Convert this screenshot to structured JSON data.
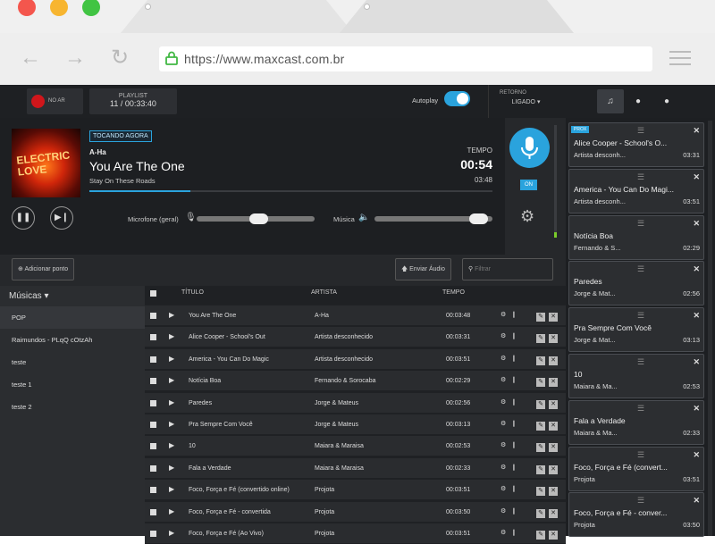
{
  "browser": {
    "url": "https://www.maxcast.com.br",
    "colors": {
      "close": "#f4564d",
      "minimize": "#f7b530",
      "maximize": "#41c443"
    }
  },
  "topbar": {
    "record_label": "NO AR",
    "playlist_label": "PLAYLIST",
    "playlist_value": "11 / 00:33:40",
    "autoplay_label": "Autoplay",
    "autoplay_on": true,
    "retorno_label": "RETORNO",
    "retorno_value": "LIGADO"
  },
  "nowplaying": {
    "badge": "TOCANDO AGORA",
    "artist": "A-Ha",
    "title": "You Are The One",
    "album": "Stay On These Roads",
    "tempo_label": "TEMPO",
    "elapsed": "00:54",
    "duration": "03:48",
    "progress": 0.25,
    "cover_text": "ELECTRIC LOVE",
    "mic_label": "Microfone (geral)",
    "music_label": "Música",
    "mic_level": 0.52,
    "music_level": 0.88
  },
  "mic": {
    "on_label": "ON"
  },
  "actions": {
    "add_label": "Adicionar ponto",
    "send_audio_label": "Enviar Áudio",
    "filter_placeholder": "Filtrar"
  },
  "sidebar": {
    "header": "Músicas",
    "items": [
      "POP",
      "Raimundos - PLqQ cOtzAh",
      "teste",
      "teste 1",
      "teste 2"
    ]
  },
  "table": {
    "headers": {
      "title": "TÍTULO",
      "artist": "ARTISTA",
      "time": "TEMPO"
    },
    "rows": [
      {
        "title": "You Are The One",
        "artist": "A-Ha",
        "time": "00:03:48"
      },
      {
        "title": "Alice Cooper - School's Out",
        "artist": "Artista desconhecido",
        "time": "00:03:31"
      },
      {
        "title": "America - You Can Do Magic",
        "artist": "Artista desconhecido",
        "time": "00:03:51"
      },
      {
        "title": "Notícia Boa",
        "artist": "Fernando & Sorocaba",
        "time": "00:02:29"
      },
      {
        "title": "Paredes",
        "artist": "Jorge & Mateus",
        "time": "00:02:56"
      },
      {
        "title": "Pra Sempre Com Você",
        "artist": "Jorge & Mateus",
        "time": "00:03:13"
      },
      {
        "title": "10",
        "artist": "Maiara & Maraisa",
        "time": "00:02:53"
      },
      {
        "title": "Fala a Verdade",
        "artist": "Maiara & Maraisa",
        "time": "00:02:33"
      },
      {
        "title": "Foco, Força e Fé (convertido online)",
        "artist": "Projota",
        "time": "00:03:51"
      },
      {
        "title": "Foco, Força e Fé - convertida",
        "artist": "Projota",
        "time": "00:03:50"
      },
      {
        "title": "Foco, Força e Fé (Ao Vivo)",
        "artist": "Projota",
        "time": "00:03:51"
      }
    ]
  },
  "queue": {
    "next_badge": "PROX",
    "items": [
      {
        "title": "Alice Cooper - School's O...",
        "artist": "Artista desconh...",
        "time": "03:31"
      },
      {
        "title": "America - You Can Do Magi...",
        "artist": "Artista desconh...",
        "time": "03:51"
      },
      {
        "title": "Notícia Boa",
        "artist": "Fernando & S...",
        "time": "02:29"
      },
      {
        "title": "Paredes",
        "artist": "Jorge & Mat...",
        "time": "02:56"
      },
      {
        "title": "Pra Sempre Com Você",
        "artist": "Jorge & Mat...",
        "time": "03:13"
      },
      {
        "title": "10",
        "artist": "Maiara & Ma...",
        "time": "02:53"
      },
      {
        "title": "Fala a Verdade",
        "artist": "Maiara & Ma...",
        "time": "02:33"
      },
      {
        "title": "Foco, Força e Fé (convert...",
        "artist": "Projota",
        "time": "03:51"
      },
      {
        "title": "Foco, Força e Fé - conver...",
        "artist": "Projota",
        "time": "03:50"
      }
    ]
  }
}
